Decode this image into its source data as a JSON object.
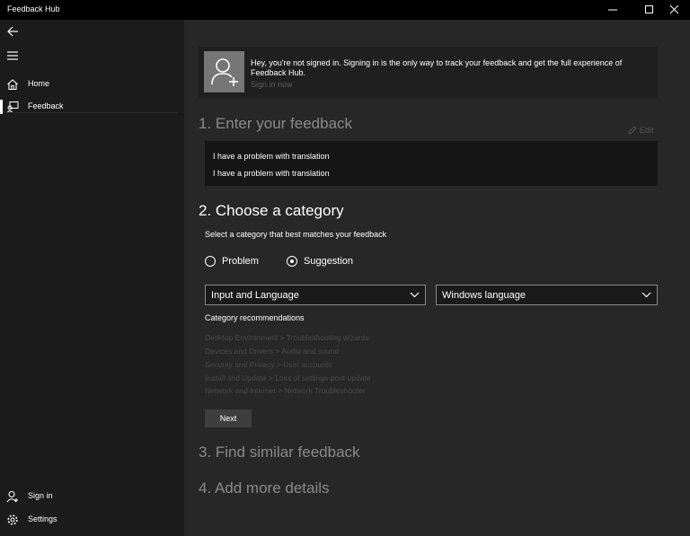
{
  "window": {
    "title": "Feedback Hub",
    "controls": [
      "minimize-icon",
      "maximize-icon",
      "close-icon"
    ]
  },
  "sidebar": {
    "back_icon": "back-arrow-icon",
    "menu_icon": "hamburger-menu-icon",
    "items": [
      {
        "label": "Home",
        "icon": "home-icon",
        "selected": false
      },
      {
        "label": "Feedback",
        "icon": "feedback-icon",
        "selected": true
      }
    ],
    "footer": [
      {
        "label": "Sign in",
        "icon": "person-icon"
      },
      {
        "label": "Settings",
        "icon": "gear-icon"
      }
    ]
  },
  "banner": {
    "message": "Hey, you're not signed in. Signing in is the only way to track your feedback and get the full experience of Feedback Hub.",
    "link": "Sign in now"
  },
  "step1": {
    "heading": "1. Enter your feedback",
    "edit_label": "Edit",
    "summary": "I have a problem with translation",
    "details": "I have a problem with translation"
  },
  "step2": {
    "heading": "2. Choose a category",
    "instruction": "Select a category that best matches your feedback",
    "options": [
      {
        "label": "Problem",
        "selected": false
      },
      {
        "label": "Suggestion",
        "selected": true
      }
    ],
    "category": "Input and Language",
    "subcategory": "Windows language",
    "recs_title": "Category recommendations",
    "recommendations": [
      "Desktop Environment > Troubleshooting wizards",
      "Devices and Drivers > Audio and sound",
      "Security and Privacy > User accounts",
      "Install and Update > Loss of settings post-update",
      "Network and Internet > Network Troubleshooter"
    ],
    "next_label": "Next"
  },
  "step3": {
    "heading": "3. Find similar feedback"
  },
  "step4": {
    "heading": "4. Add more details"
  },
  "colors": {
    "background": "#272727",
    "sidebar": "#1b1b1b",
    "titlebar": "#000000",
    "heading_active": "#ffffff",
    "heading_inactive": "#8a8a8a",
    "muted_text": "#4a4a4a"
  }
}
